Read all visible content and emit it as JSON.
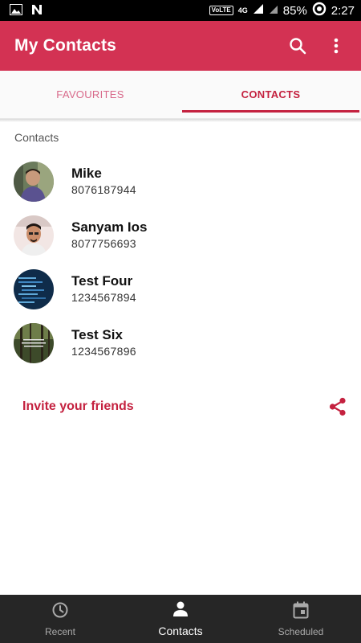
{
  "status_bar": {
    "volte": "VoLTE",
    "network": "4G",
    "battery": "85%",
    "time": "2:27"
  },
  "app_bar": {
    "title": "My Contacts",
    "icons": [
      "search-icon",
      "more-vert-icon"
    ]
  },
  "tabs": [
    {
      "label": "FAVOURITES",
      "selected": false
    },
    {
      "label": "CONTACTS",
      "selected": true
    }
  ],
  "section_header": "Contacts",
  "contacts": [
    {
      "name": "Mike",
      "phone": "8076187944"
    },
    {
      "name": "Sanyam Ios",
      "phone": "8077756693"
    },
    {
      "name": "Test Four",
      "phone": "1234567894"
    },
    {
      "name": "Test Six",
      "phone": "1234567896"
    }
  ],
  "invite": {
    "label": "Invite your friends",
    "icon": "share-icon"
  },
  "bottom_nav": [
    {
      "label": "Recent",
      "icon": "clock-icon",
      "active": false
    },
    {
      "label": "Contacts",
      "icon": "person-icon",
      "active": true
    },
    {
      "label": "Scheduled",
      "icon": "calendar-icon",
      "active": false
    }
  ],
  "colors": {
    "primary": "#d33253",
    "accent": "#c4213f",
    "nav_background": "#262626"
  }
}
